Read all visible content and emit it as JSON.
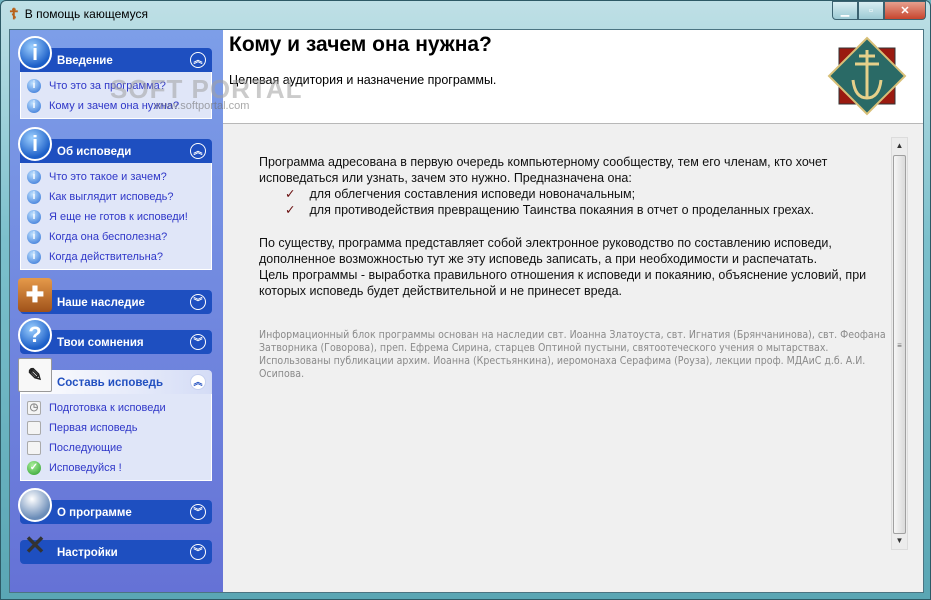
{
  "window": {
    "title": "В помощь кающемуся",
    "icon": "orthodox-cross-icon",
    "controls": [
      "minimize",
      "maximize",
      "close"
    ]
  },
  "sidebar": {
    "groups": [
      {
        "title": "Введение",
        "icon": "info-icon",
        "expanded": true,
        "items": [
          {
            "label": "Что это за программа?",
            "icon": "info-icon"
          },
          {
            "label": "Кому и зачем она нужна?",
            "icon": "info-icon"
          }
        ]
      },
      {
        "title": "Об исповеди",
        "icon": "info-icon",
        "expanded": true,
        "items": [
          {
            "label": "Что это такое и зачем?"
          },
          {
            "label": "Как выглядит исповедь?"
          },
          {
            "label": "Я еще не готов к исповеди!"
          },
          {
            "label": "Когда она бесполезна?"
          },
          {
            "label": "Когда действительна?"
          }
        ]
      },
      {
        "title": "Наше наследие",
        "icon": "book-icon",
        "expanded": false
      },
      {
        "title": "Твои сомнения",
        "icon": "question-icon",
        "expanded": false
      },
      {
        "title": "Составь исповедь",
        "icon": "notepad-pen-icon",
        "expanded": true,
        "items": [
          {
            "label": "Подготовка к исповеди",
            "icon": "clock-document-icon"
          },
          {
            "label": "Первая исповедь",
            "icon": "tag-icon"
          },
          {
            "label": "Последующие",
            "icon": "tags-icon"
          },
          {
            "label": "Исповедуйся !",
            "icon": "green-check-icon"
          }
        ]
      },
      {
        "title": "О программе",
        "icon": "globe-icon",
        "expanded": false
      },
      {
        "title": "Настройки",
        "icon": "tools-icon",
        "expanded": false
      }
    ]
  },
  "watermark": {
    "text": "SOFTPORTAL",
    "url": "www.softportal.com"
  },
  "main": {
    "title": "Кому и зачем она нужна?",
    "subtitle": "Целевая аудитория и назначение программы.",
    "p1": "Программа адресована в первую очередь компьютерному сообществу, тем его членам, кто хочет исповедаться или узнать, зачем это нужно. Предназначена она:",
    "bullets": [
      "для облегчения составления исповеди новоначальным;",
      "для противодействия превращению Таинства покаяния в отчет о проделанных грехах."
    ],
    "p2": "По существу, программа представляет собой электронное руководство по составлению исповеди, дополненное возможностью тут же эту исповедь записать, а при необходимости и распечатать.",
    "p3": "Цель программы - выработка правильного отношения к исповеди и покаянию, объяснение условий, при которых исповедь будет действительной и не принесет вреда.",
    "note": "Информационный блок программы основан на наследии свт. Иоанна Златоуста, свт. Игнатия (Брянчанинова), свт. Феофана Затворника (Говорова), преп. Ефрема Сирина, старцев Оптиной пустыни, святоотеческого учения о мытарствах. Использованы публикации архим. Иоанна (Крестьянкина), иеромонаха Серафима (Роуза), лекции проф. МДАиС д.б. А.И. Осипова."
  }
}
